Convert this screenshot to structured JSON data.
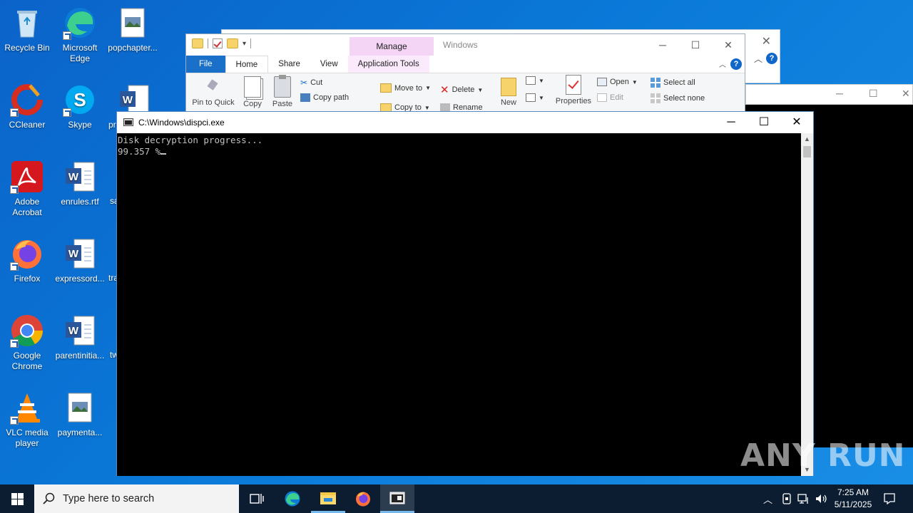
{
  "desktop": {
    "icons": [
      {
        "label": "Recycle Bin"
      },
      {
        "label": "Microsoft Edge"
      },
      {
        "label": "popchapter..."
      },
      {
        "label": "CCleaner"
      },
      {
        "label": "Skype"
      },
      {
        "label": "pr"
      },
      {
        "label": "Adobe Acrobat"
      },
      {
        "label": "enrules.rtf"
      },
      {
        "label": "sa"
      },
      {
        "label": "Firefox"
      },
      {
        "label": "expressord..."
      },
      {
        "label": "tra"
      },
      {
        "label": "Google Chrome"
      },
      {
        "label": "parentinitia..."
      },
      {
        "label": "tw"
      },
      {
        "label": "VLC media player"
      },
      {
        "label": "paymenta..."
      }
    ]
  },
  "explorer": {
    "title": "Windows",
    "manage_tab": "Manage",
    "tabs": {
      "file": "File",
      "home": "Home",
      "share": "Share",
      "view": "View",
      "app_tools": "Application Tools"
    },
    "ribbon": {
      "pin": "Pin to Quick",
      "copy": "Copy",
      "paste": "Paste",
      "cut": "Cut",
      "copy_path": "Copy path",
      "move_to": "Move to",
      "copy_to": "Copy to",
      "delete": "Delete",
      "rename": "Rename",
      "new": "New",
      "properties": "Properties",
      "open": "Open",
      "edit": "Edit",
      "select_all": "Select all",
      "select_none": "Select none"
    }
  },
  "console": {
    "title": "C:\\Windows\\dispci.exe",
    "lines": [
      "Disk decryption progress...",
      "99.357 %"
    ]
  },
  "watermark": "ANY RUN",
  "taskbar": {
    "search_placeholder": "Type here to search",
    "time": "7:25 AM",
    "date": "5/11/2025"
  },
  "colors": {
    "desktop": "#0a79d8",
    "taskbar": "#0c1d31",
    "console_bg": "#000000",
    "console_text": "#c0c0c0",
    "accent": "#1a6fc9"
  }
}
